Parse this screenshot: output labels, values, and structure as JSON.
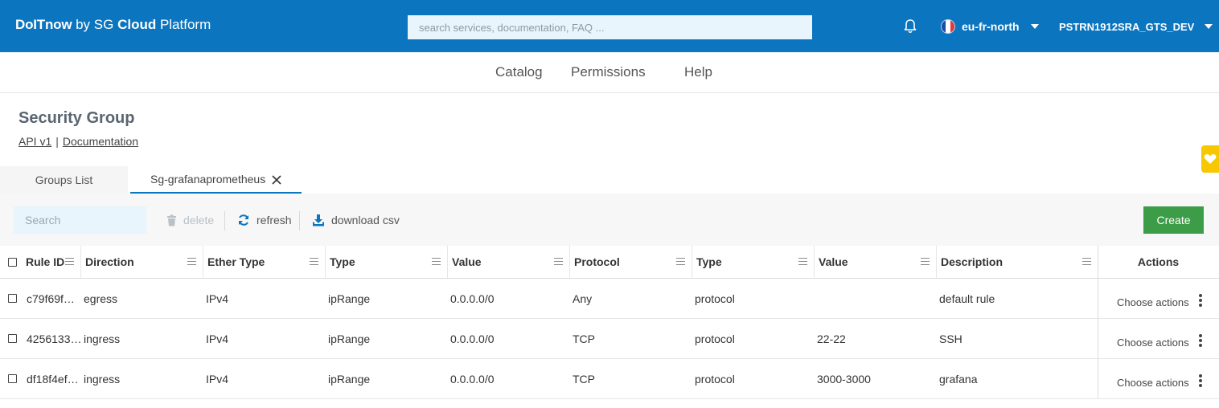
{
  "header": {
    "brand_part1": "DoITnow",
    "brand_part2": " by SG ",
    "brand_part3": "Cloud",
    "brand_part4": " Platform",
    "search_placeholder": "search services, documentation, FAQ ...",
    "region": "eu-fr-north",
    "account": "PSTRN1912SRA_GTS_DEV",
    "accent_color": "#0c75bf"
  },
  "nav": {
    "catalog": "Catalog",
    "permissions": "Permissions",
    "help": "Help"
  },
  "page": {
    "title": "Security Group",
    "link_api": "API v1",
    "link_sep": "|",
    "link_docs": "Documentation"
  },
  "tabs": {
    "groups_list": "Groups List",
    "active": "Sg-grafanaprometheus"
  },
  "toolbar": {
    "search_placeholder": "Search",
    "delete": "delete",
    "refresh": "refresh",
    "download": "download csv",
    "create": "Create",
    "create_color": "#3d9c47"
  },
  "table": {
    "columns": [
      "Rule ID",
      "Direction",
      "Ether Type",
      "Type",
      "Value",
      "Protocol",
      "Type",
      "Value",
      "Description"
    ],
    "actions_header": "Actions",
    "actions_label": "Choose actions",
    "rows": [
      [
        "c79f69f…",
        "egress",
        "IPv4",
        "ipRange",
        "0.0.0.0/0",
        "Any",
        "protocol",
        "",
        "default rule"
      ],
      [
        "4256133…",
        "ingress",
        "IPv4",
        "ipRange",
        "0.0.0.0/0",
        "TCP",
        "protocol",
        "22-22",
        "SSH"
      ],
      [
        "df18f4ef…",
        "ingress",
        "IPv4",
        "ipRange",
        "0.0.0.0/0",
        "TCP",
        "protocol",
        "3000-3000",
        "grafana"
      ]
    ]
  }
}
